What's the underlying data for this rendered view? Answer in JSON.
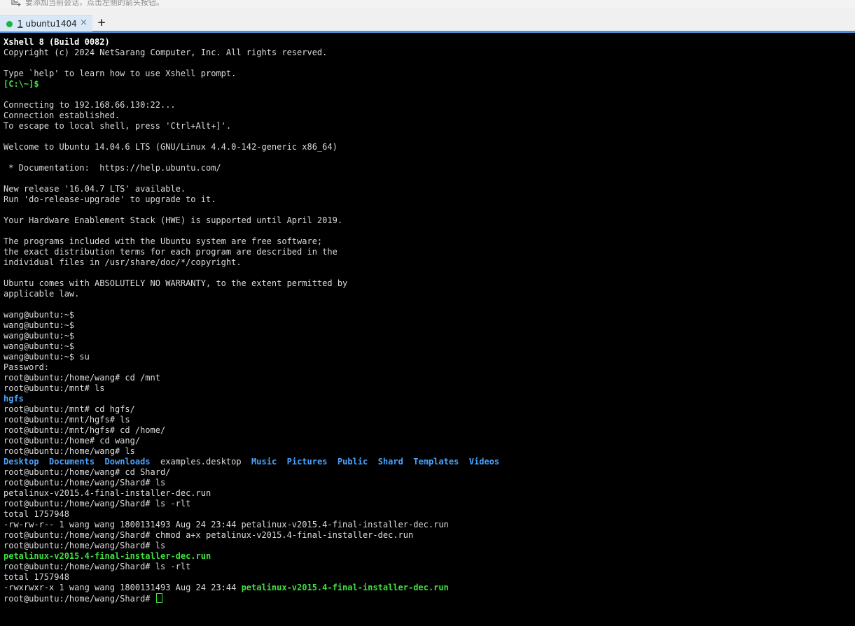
{
  "hint_bar": {
    "text": "要添加当前会话，点击左侧的箭头按钮。",
    "icon": "add-session-icon"
  },
  "tabs": [
    {
      "number": "1",
      "label": "ubuntu1404",
      "status_color": "#19b43c",
      "active": true
    }
  ],
  "tab_close_symbol": "×",
  "add_tab_symbol": "+",
  "colors": {
    "accent": "#4a90d9",
    "terminal_bg": "#000000",
    "text": "#dcdcdc",
    "prompt_green": "#3fe03f",
    "directory_blue": "#4aa3ff"
  },
  "terminal": {
    "lines": [
      [
        {
          "t": "Xshell 8 (Build 0082)",
          "c": "bold"
        }
      ],
      [
        {
          "t": "Copyright (c) 2024 NetSarang Computer, Inc. All rights reserved."
        }
      ],
      [],
      [
        {
          "t": "Type `help' to learn how to use Xshell prompt."
        }
      ],
      [
        {
          "t": "[C:\\~]$",
          "c": "green"
        }
      ],
      [],
      [
        {
          "t": "Connecting to 192.168.66.130:22..."
        }
      ],
      [
        {
          "t": "Connection established."
        }
      ],
      [
        {
          "t": "To escape to local shell, press 'Ctrl+Alt+]'."
        }
      ],
      [],
      [
        {
          "t": "Welcome to Ubuntu 14.04.6 LTS (GNU/Linux 4.4.0-142-generic x86_64)"
        }
      ],
      [],
      [
        {
          "t": " * Documentation:  https://help.ubuntu.com/"
        }
      ],
      [],
      [
        {
          "t": "New release '16.04.7 LTS' available."
        }
      ],
      [
        {
          "t": "Run 'do-release-upgrade' to upgrade to it."
        }
      ],
      [],
      [
        {
          "t": "Your Hardware Enablement Stack (HWE) is supported until April 2019."
        }
      ],
      [],
      [
        {
          "t": "The programs included with the Ubuntu system are free software;"
        }
      ],
      [
        {
          "t": "the exact distribution terms for each program are described in the"
        }
      ],
      [
        {
          "t": "individual files in /usr/share/doc/*/copyright."
        }
      ],
      [],
      [
        {
          "t": "Ubuntu comes with ABSOLUTELY NO WARRANTY, to the extent permitted by"
        }
      ],
      [
        {
          "t": "applicable law."
        }
      ],
      [],
      [
        {
          "t": "wang@ubuntu:~$"
        }
      ],
      [
        {
          "t": "wang@ubuntu:~$"
        }
      ],
      [
        {
          "t": "wang@ubuntu:~$"
        }
      ],
      [
        {
          "t": "wang@ubuntu:~$"
        }
      ],
      [
        {
          "t": "wang@ubuntu:~$ su"
        }
      ],
      [
        {
          "t": "Password:"
        }
      ],
      [
        {
          "t": "root@ubuntu:/home/wang# cd /mnt"
        }
      ],
      [
        {
          "t": "root@ubuntu:/mnt# ls"
        }
      ],
      [
        {
          "t": "hgfs",
          "c": "dir"
        }
      ],
      [
        {
          "t": "root@ubuntu:/mnt# cd hgfs/"
        }
      ],
      [
        {
          "t": "root@ubuntu:/mnt/hgfs# ls"
        }
      ],
      [
        {
          "t": "root@ubuntu:/mnt/hgfs# cd /home/"
        }
      ],
      [
        {
          "t": "root@ubuntu:/home# cd wang/"
        }
      ],
      [
        {
          "t": "root@ubuntu:/home/wang# ls"
        }
      ],
      [
        {
          "t": "Desktop",
          "c": "dir"
        },
        {
          "t": "  "
        },
        {
          "t": "Documents",
          "c": "dir"
        },
        {
          "t": "  "
        },
        {
          "t": "Downloads",
          "c": "dir"
        },
        {
          "t": "  examples.desktop  "
        },
        {
          "t": "Music",
          "c": "dir"
        },
        {
          "t": "  "
        },
        {
          "t": "Pictures",
          "c": "dir"
        },
        {
          "t": "  "
        },
        {
          "t": "Public",
          "c": "dir"
        },
        {
          "t": "  "
        },
        {
          "t": "Shard",
          "c": "dir"
        },
        {
          "t": "  "
        },
        {
          "t": "Templates",
          "c": "dir"
        },
        {
          "t": "  "
        },
        {
          "t": "Videos",
          "c": "dir"
        }
      ],
      [
        {
          "t": "root@ubuntu:/home/wang# cd Shard/"
        }
      ],
      [
        {
          "t": "root@ubuntu:/home/wang/Shard# ls"
        }
      ],
      [
        {
          "t": "petalinux-v2015.4-final-installer-dec.run"
        }
      ],
      [
        {
          "t": "root@ubuntu:/home/wang/Shard# ls -rlt"
        }
      ],
      [
        {
          "t": "total 1757948"
        }
      ],
      [
        {
          "t": "-rw-rw-r-- 1 wang wang 1800131493 Aug 24 23:44 petalinux-v2015.4-final-installer-dec.run"
        }
      ],
      [
        {
          "t": "root@ubuntu:/home/wang/Shard# chmod a+x petalinux-v2015.4-final-installer-dec.run"
        }
      ],
      [
        {
          "t": "root@ubuntu:/home/wang/Shard# ls"
        }
      ],
      [
        {
          "t": "petalinux-v2015.4-final-installer-dec.run",
          "c": "exec"
        }
      ],
      [
        {
          "t": "root@ubuntu:/home/wang/Shard# ls -rlt"
        }
      ],
      [
        {
          "t": "total 1757948"
        }
      ],
      [
        {
          "t": "-rwxrwxr-x 1 wang wang 1800131493 Aug 24 23:44 "
        },
        {
          "t": "petalinux-v2015.4-final-installer-dec.run",
          "c": "exec"
        }
      ],
      [
        {
          "t": "root@ubuntu:/home/wang/Shard# "
        }
      ]
    ]
  }
}
